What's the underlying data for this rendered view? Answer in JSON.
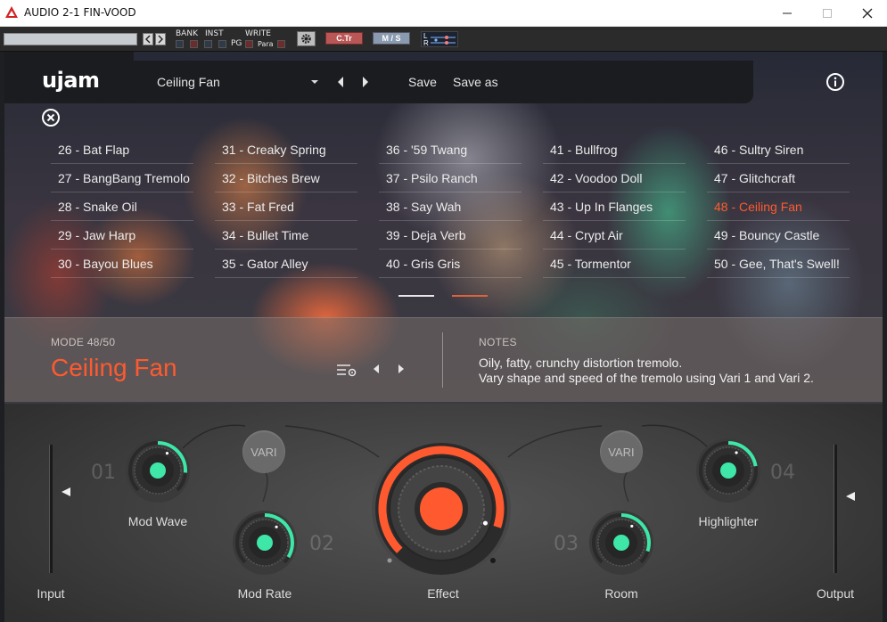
{
  "window": {
    "title": "AUDIO 2-1 FIN-VOOD"
  },
  "host": {
    "labels": {
      "bank": "BANK",
      "inst": "INST",
      "write": "WRITE",
      "pg": "PG",
      "para": "Para"
    },
    "ctr_label": "C.Tr",
    "ms_label": "M / S",
    "lr_l": "L",
    "lr_r": "R"
  },
  "plugin": {
    "logo": "ujam",
    "preset_name": "Ceiling Fan",
    "save_label": "Save",
    "saveas_label": "Save as"
  },
  "presets": {
    "columns": [
      [
        "26 - Bat Flap",
        "27 - BangBang Tremolo",
        "28 - Snake Oil",
        "29 - Jaw Harp",
        "30 - Bayou Blues"
      ],
      [
        "31 - Creaky Spring",
        "32 - Bitches Brew",
        "33 - Fat Fred",
        "34 - Bullet Time",
        "35 - Gator Alley"
      ],
      [
        "36 - '59 Twang",
        "37 - Psilo Ranch",
        "38 - Say Wah",
        "39 - Deja Verb",
        "40 - Gris Gris"
      ],
      [
        "41 - Bullfrog",
        "42 - Voodoo Doll",
        "43 - Up In Flanges",
        "44 - Crypt Air",
        "45 - Tormentor"
      ],
      [
        "46 - Sultry Siren",
        "47 - Glitchcraft",
        "48 - Ceiling Fan",
        "49 - Bouncy Castle",
        "50 - Gee, That's Swell!"
      ]
    ],
    "active": "48 - Ceiling Fan"
  },
  "mode": {
    "label": "MODE 48/50",
    "name": "Ceiling Fan",
    "notes_label": "NOTES",
    "notes_line1": "Oily, fatty, crunchy distortion tremolo.",
    "notes_line2": "Vary shape and speed of the tremolo using Vari 1 and Vari 2."
  },
  "controls": {
    "input_label": "Input",
    "output_label": "Output",
    "mod_wave_label": "Mod Wave",
    "mod_rate_label": "Mod Rate",
    "effect_label": "Effect",
    "room_label": "Room",
    "highlighter_label": "Highlighter",
    "vari1_label": "VARI",
    "vari2_label": "VARI",
    "num_01": "01",
    "num_02": "02",
    "num_03": "03",
    "num_04": "04",
    "mod_wave_value": 0.35,
    "mod_rate_value": 0.45,
    "effect_value": 0.9,
    "room_value": 0.4,
    "highlighter_value": 0.3
  },
  "colors": {
    "accent": "#ff5a2f",
    "knob_green": "#3ee6a8"
  }
}
